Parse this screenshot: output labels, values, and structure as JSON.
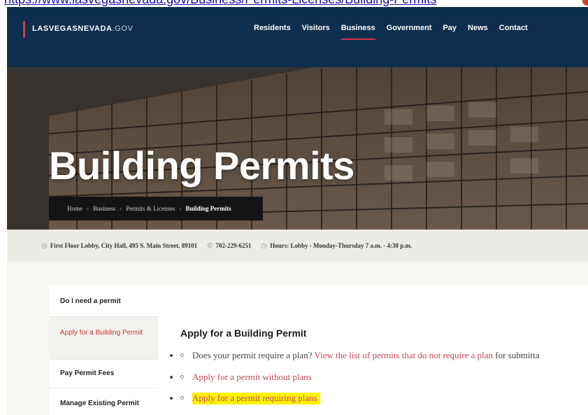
{
  "top_link": {
    "text": "https://www.lasvegasnevada.gov/Business/Permits-Licenses/Building-Permits"
  },
  "header": {
    "logo_main": "LASVEGASNEVADA",
    "logo_suffix": ".GOV",
    "nav": [
      {
        "label": "Residents"
      },
      {
        "label": "Visitors"
      },
      {
        "label": "Business",
        "active": true
      },
      {
        "label": "Government"
      },
      {
        "label": "Pay"
      },
      {
        "label": "News"
      },
      {
        "label": "Contact"
      }
    ]
  },
  "hero": {
    "title": "Building Permits",
    "breadcrumb": [
      "Home",
      "Business",
      "Permits & Licenses",
      "Building Permits"
    ]
  },
  "info": {
    "address": "First Floor Lobby, City Hall, 495 S. Main Street, 89101",
    "phone": "702-229-6251",
    "hours": "Hours: Lobby - Monday-Thursday 7 a.m. - 4:30 p.m."
  },
  "sidebar": {
    "items": [
      {
        "label": "Do I need a permit"
      },
      {
        "label": "Apply for a Building Permit",
        "active": true
      },
      {
        "label": "Pay Permit Fees"
      },
      {
        "label": "Manage Existing Permit"
      }
    ]
  },
  "main": {
    "title": "Apply for a Building Permit",
    "bullet1_text": "Does your permit require a plan?",
    "bullet1_link": "View the list of permits that do not require a plan",
    "bullet1_tail": "for submitta",
    "bullet2_link": "Apply for a permit without plans",
    "bullet3_link": "Apply for a permit requiring plans"
  },
  "colors": {
    "header_bg": "#0d2e4d",
    "accent": "#d2364a",
    "link": "#c4475a",
    "highlight": "#fff200"
  }
}
